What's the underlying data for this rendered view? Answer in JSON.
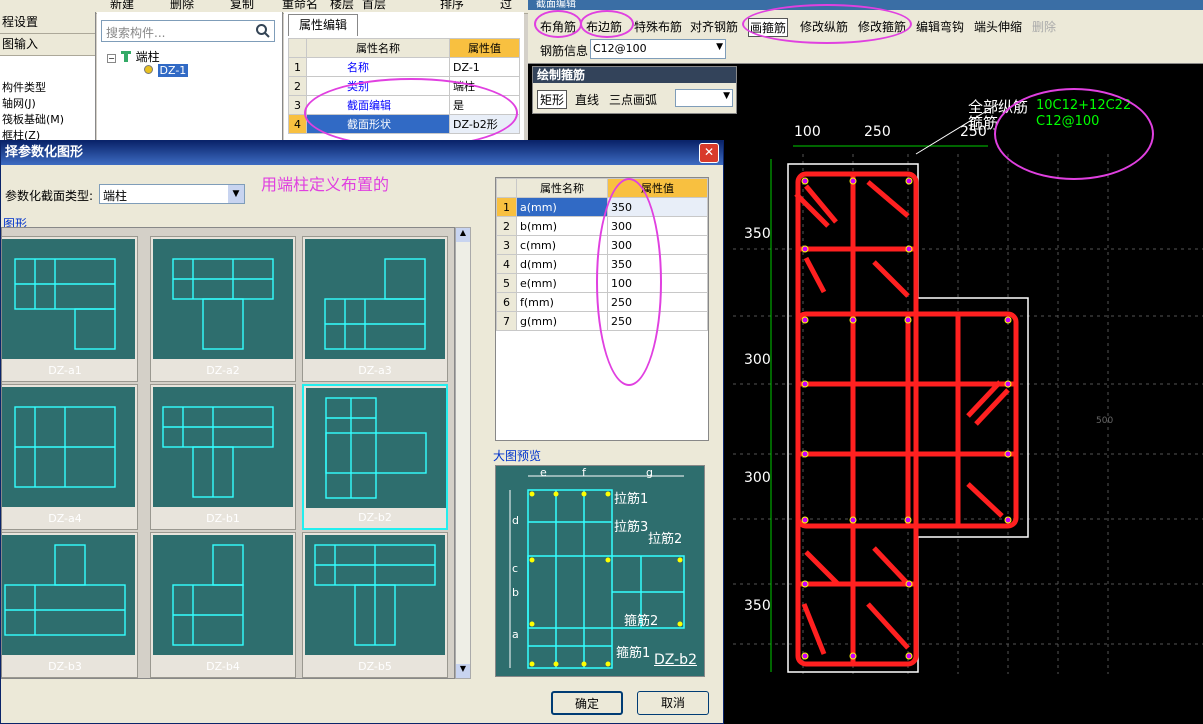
{
  "topbar": {
    "items": [
      "新建",
      "删除",
      "复制",
      "重命名",
      "楼层",
      "首层",
      "排序",
      "过"
    ]
  },
  "left_nav": {
    "header": "程设置",
    "subheader": "图输入",
    "items": [
      "构件类型",
      "轴网(J)",
      "筏板基础(M)",
      "框柱(Z)"
    ]
  },
  "tree": {
    "search_placeholder": "搜索构件...",
    "root": "端柱",
    "child": "DZ-1"
  },
  "props": {
    "tab": "属性编辑",
    "col_name": "属性名称",
    "col_value": "属性值",
    "rows": [
      {
        "no": "1",
        "name": "名称",
        "value": "DZ-1"
      },
      {
        "no": "2",
        "name": "类别",
        "value": "端柱"
      },
      {
        "no": "3",
        "name": "截面编辑",
        "value": "是"
      },
      {
        "no": "4",
        "name": "截面形状",
        "value": "DZ-b2形"
      }
    ]
  },
  "section_editor": {
    "title": "截面编辑",
    "toolbar": [
      "布角筋",
      "布边筋",
      "特殊布筋",
      "对齐钢筋",
      "画箍筋",
      "修改纵筋",
      "修改箍筋",
      "编辑弯钩",
      "端头伸缩",
      "删除"
    ],
    "rebar_info_label": "钢筋信息",
    "rebar_info_value": "C12@100",
    "draw_stirrup": {
      "title": "绘制箍筋",
      "shape_active": "矩形",
      "line": "直线",
      "arc": "三点画弧"
    },
    "labels": {
      "all_long_bars": "全部纵筋",
      "stirrup": "箍筋",
      "long_bar_spec": "10C12+12C22",
      "stirrup_spec": "C12@100"
    },
    "dims_top": [
      "100",
      "250",
      "250"
    ],
    "dims_left": [
      "350",
      "300",
      "300",
      "350"
    ],
    "faint_500": "500"
  },
  "dialog": {
    "title": "择参数化图形",
    "type_label": "参数化截面类型:",
    "type_value": "端柱",
    "note": "用端柱定义布置的",
    "group_label": "图形",
    "shapes": [
      "DZ-a1",
      "DZ-a2",
      "DZ-a3",
      "DZ-a4",
      "DZ-b1",
      "DZ-b2",
      "DZ-b3",
      "DZ-b4",
      "DZ-b5"
    ],
    "selected": "DZ-b2",
    "param_col_name": "属性名称",
    "param_col_value": "属性值",
    "params": [
      {
        "no": "1",
        "name": "a(mm)",
        "value": "350"
      },
      {
        "no": "2",
        "name": "b(mm)",
        "value": "300"
      },
      {
        "no": "3",
        "name": "c(mm)",
        "value": "300"
      },
      {
        "no": "4",
        "name": "d(mm)",
        "value": "350"
      },
      {
        "no": "5",
        "name": "e(mm)",
        "value": "100"
      },
      {
        "no": "6",
        "name": "f(mm)",
        "value": "250"
      },
      {
        "no": "7",
        "name": "g(mm)",
        "value": "250"
      }
    ],
    "preview_label": "大图预览",
    "preview_labels": {
      "tie1": "拉筋1",
      "tie3": "拉筋3",
      "tie2": "拉筋2",
      "stirrup2": "箍筋2",
      "stirrup1": "箍筋1",
      "name": "DZ-b2",
      "e": "e",
      "f": "f",
      "g": "g",
      "d": "d",
      "c": "c",
      "b": "b",
      "a": "a"
    },
    "ok": "确定",
    "cancel": "取消"
  },
  "colors": {
    "accent_annotation": "#e040e0",
    "rebar": "#ff2020",
    "canvas": "#000000",
    "thumb_bg": "#2e6e6e"
  }
}
